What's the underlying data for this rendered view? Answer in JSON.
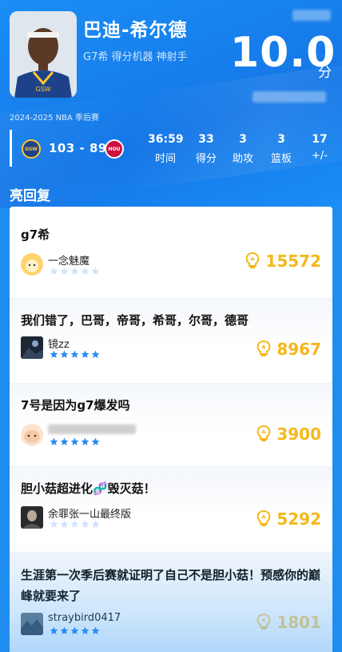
{
  "player": {
    "name": "巴迪-希尔德",
    "tagline": "G7希 得分机器 神射手",
    "score": "10.0",
    "score_unit": "分",
    "season": "2024-2025 NBA 季后赛"
  },
  "game": {
    "home_team": "GSW",
    "away_team": "HOU",
    "score": "103 - 89",
    "stats": [
      {
        "value": "36:59",
        "label": "时间"
      },
      {
        "value": "33",
        "label": "得分"
      },
      {
        "value": "3",
        "label": "助攻"
      },
      {
        "value": "3",
        "label": "篮板"
      },
      {
        "value": "17",
        "label": "+/-"
      }
    ]
  },
  "section_title": "亮回复",
  "comments": [
    {
      "text": "g7希",
      "user": "一念魅魔",
      "likes": "15572",
      "rating": 0
    },
    {
      "text": "我们错了，巴哥，帝哥，希哥，尔哥，德哥",
      "user": "镜zz",
      "likes": "8967",
      "rating": 5
    },
    {
      "text": "7号是因为g7爆发吗",
      "user": "",
      "likes": "3900",
      "rating": 5
    },
    {
      "text": "胆小菇超进化🧬毁灭菇！",
      "user": "余罪张一山最终版",
      "likes": "5292",
      "rating": 0
    },
    {
      "text": "生涯第一次季后赛就证明了自己不是胆小菇！预感你的巅峰就要来了",
      "user": "straybird0417",
      "likes": "1801",
      "rating": 5
    }
  ],
  "colors": {
    "header_blue": "#1a8ef6",
    "like_gold": "#f4b81c",
    "star_blue": "#2b8cf0",
    "star_empty": "#cfe3fb"
  }
}
